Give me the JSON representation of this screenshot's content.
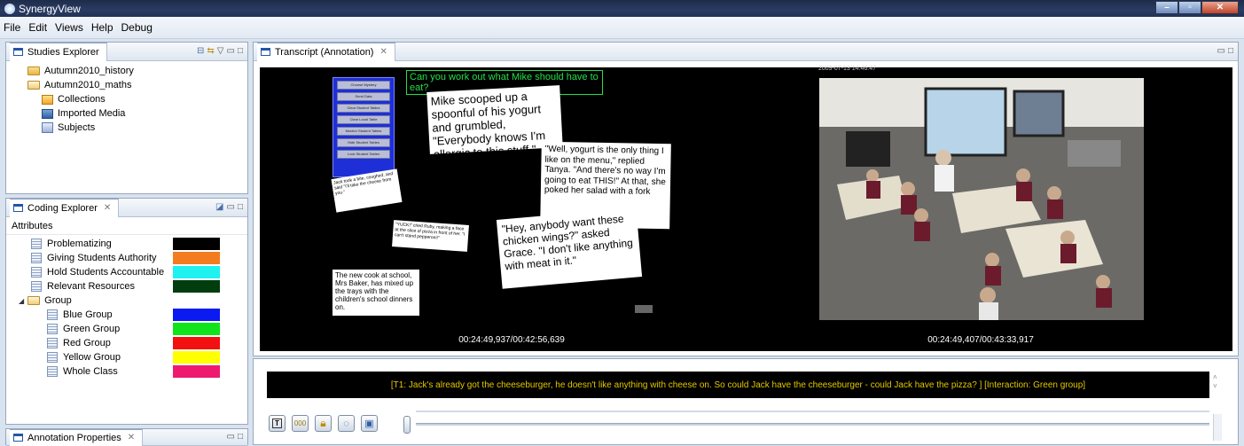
{
  "window": {
    "title": "SynergyView"
  },
  "menubar": {
    "items": [
      "File",
      "Edit",
      "Views",
      "Help",
      "Debug"
    ]
  },
  "studies_explorer": {
    "tab_label": "Studies Explorer",
    "tree": [
      {
        "label": "Autumn2010_history",
        "icon": "folder-icon"
      },
      {
        "label": "Autumn2010_maths",
        "icon": "folder-open-icon"
      },
      {
        "label": "Collections",
        "icon": "collections-icon"
      },
      {
        "label": "Imported Media",
        "icon": "media-icon"
      },
      {
        "label": "Subjects",
        "icon": "subjects-icon"
      }
    ]
  },
  "coding_explorer": {
    "tab_label": "Coding Explorer",
    "section_label": "Attributes",
    "attributes": [
      {
        "label": "Problematizing",
        "color": "#000000"
      },
      {
        "label": "Giving Students Authority",
        "color": "#f37c20"
      },
      {
        "label": "Hold Students Accountable",
        "color": "#1ff1f1"
      },
      {
        "label": "Relevant Resources",
        "color": "#013d0f"
      }
    ],
    "group": {
      "label": "Group",
      "items": [
        {
          "label": "Blue Group",
          "color": "#0a1af0"
        },
        {
          "label": "Green Group",
          "color": "#10e41a"
        },
        {
          "label": "Red Group",
          "color": "#f31010"
        },
        {
          "label": "Yellow Group",
          "color": "#ffff00"
        },
        {
          "label": "Whole Class",
          "color": "#ee1a70"
        }
      ]
    }
  },
  "annotation_properties": {
    "tab_label": "Annotation Properties"
  },
  "transcript_editor": {
    "tab_label": "Transcript (Annotation)",
    "left_video": {
      "question": "Can you work out what Mike should have to eat?",
      "buttons": [
        "Choose Mystery",
        "Send Data",
        "Clear Student Tables",
        "Clear Local Table",
        "Monitor Student Tables",
        "Hide Student Tables",
        "Lock Student Tables"
      ],
      "card1": "Mike scooped up a spoonful of his yogurt and grumbled, \"Everybody knows I'm allergic to this stuff.\"",
      "card2": "\"Well, yogurt is the only thing I like on the menu,\" replied Tanya. \"And there's no way I'm going to eat THIS!\" At that, she poked her salad with a fork",
      "card3": "\"Hey, anybody want these chicken wings?\" asked Grace. \"I don't like anything with meat in it.\"",
      "card4": "Jack took a bite, coughed, and said \"I'll take the cheese from you.\"",
      "card5": "\"YUCK!\" cried Ruby, making a face at the slice of pizza in front of her. \"I can't stand pepperoni!\"",
      "card6": "The new cook at school, Mrs Baker, has mixed up the trays with the children's school dinners on.",
      "timecode": "00:24:49,937/00:42:56,639"
    },
    "right_video": {
      "overlay_timestamp": "2009-07-13 14:46:47",
      "timecode": "00:24:49,407/00:43:33,917"
    }
  },
  "annotation_bar": {
    "transcript_text": "[T1: Jack's already got the cheeseburger, he doesn't like anything with cheese on. So could Jack have the cheeseburger - could Jack have the pizza?  ] [Interaction: Green group]",
    "tool_buttons": [
      "transcript-tool",
      "numbers-tool",
      "lock-tool",
      "speech-tool",
      "save-tool"
    ]
  }
}
